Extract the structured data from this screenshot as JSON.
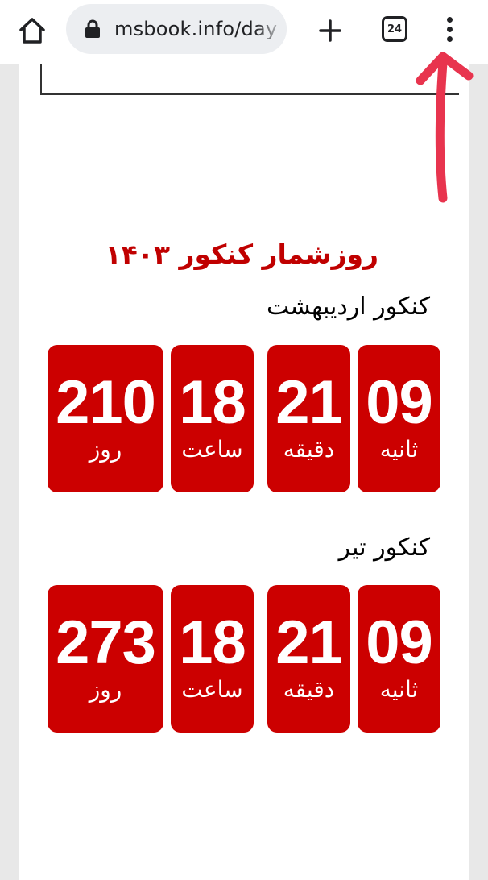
{
  "browser": {
    "url": "msbook.info/day",
    "tab_count": "24",
    "icons": {
      "home": "home-icon",
      "lock": "lock-icon",
      "new_tab": "plus-icon",
      "tabs": "tab-switcher-icon",
      "menu": "kebab-menu-icon"
    }
  },
  "page": {
    "title": "روزشمار کنکور ۱۴۰۳",
    "sections": [
      {
        "title": "کنکور اردیبهشت",
        "counters": {
          "days": "210",
          "hours": "18",
          "minutes": "21",
          "seconds": "09"
        }
      },
      {
        "title": "کنکور تیر",
        "counters": {
          "days": "273",
          "hours": "18",
          "minutes": "21",
          "seconds": "09"
        }
      }
    ],
    "labels": {
      "days": "روز",
      "hours": "ساعت",
      "minutes": "دقیقه",
      "seconds": "ثانیه"
    }
  },
  "colors": {
    "accent_red": "#cc0000",
    "title_red": "#c00000",
    "arrow_pink": "#e8344e"
  }
}
